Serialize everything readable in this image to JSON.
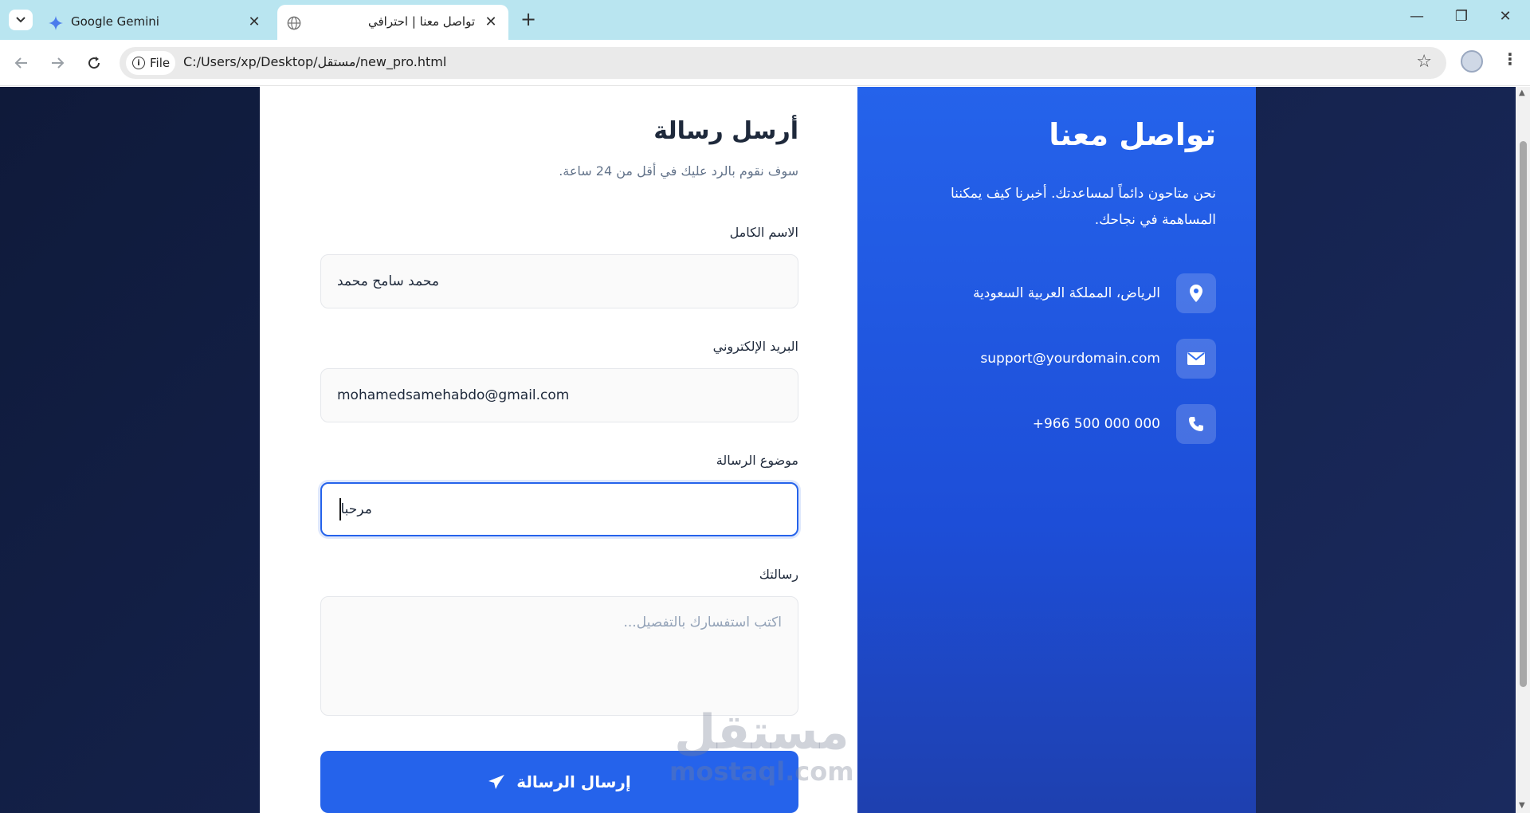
{
  "browser": {
    "tabs": [
      {
        "title": "Google Gemini",
        "active": false,
        "icon": "gemini-icon"
      },
      {
        "title": "تواصل معنا | احترافي",
        "active": true,
        "icon": "globe-icon"
      }
    ],
    "address": {
      "chip_label": "File",
      "url": "C:/Users/xp/Desktop/مستقل/new_pro.html"
    }
  },
  "form": {
    "title": "أرسل رسالة",
    "subtitle": "سوف نقوم بالرد عليك في أقل من 24 ساعة.",
    "fields": {
      "name": {
        "label": "الاسم الكامل",
        "value": "محمد سامح محمد"
      },
      "email": {
        "label": "البريد الإلكتروني",
        "value": "mohamedsamehabdo@gmail.com"
      },
      "subject": {
        "label": "موضوع الرسالة",
        "value": "مرحبا"
      },
      "message": {
        "label": "رسالتك",
        "placeholder": "اكتب استفسارك بالتفصيل..."
      }
    },
    "submit_label": "إرسال الرسالة"
  },
  "info": {
    "title": "تواصل معنا",
    "description": "نحن متاحون دائماً لمساعدتك. أخبرنا كيف يمكننا المساهمة في نجاحك.",
    "contacts": [
      {
        "icon": "location-pin-icon",
        "text": "الرياض، المملكة العربية السعودية"
      },
      {
        "icon": "envelope-icon",
        "text": "support@yourdomain.com"
      },
      {
        "icon": "phone-icon",
        "text": "+966 500 000 000"
      }
    ]
  },
  "watermark": {
    "arabic": "مستقل",
    "latin": "mostaql.com"
  },
  "colors": {
    "accent": "#2563eb",
    "tabstrip": "#b9e5f0",
    "page_bg": "#0f1a3a"
  }
}
